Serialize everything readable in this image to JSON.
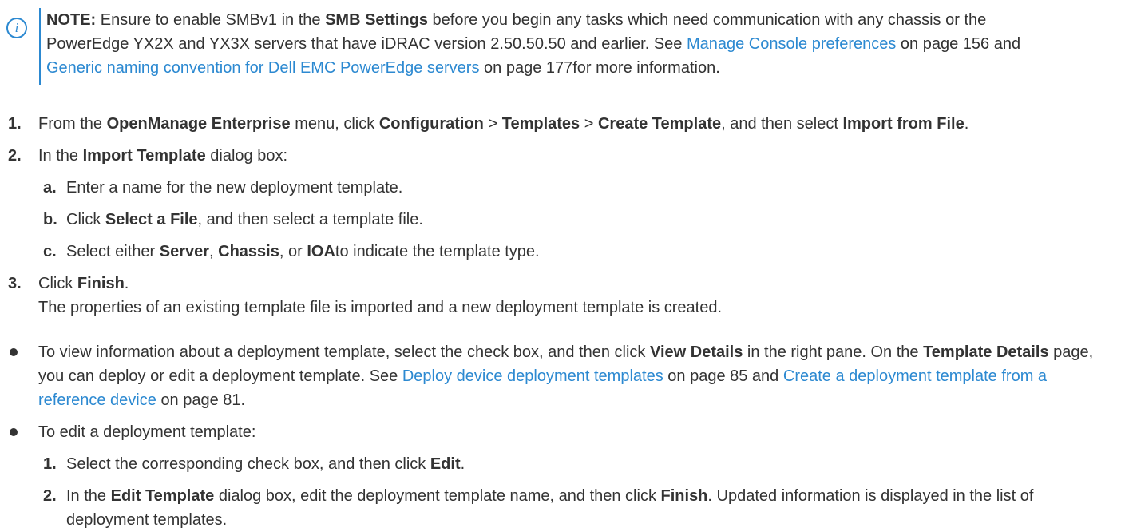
{
  "note": {
    "label": "NOTE:",
    "t1": "Ensure to enable SMBv1 in the",
    "b1": "SMB Settings",
    "t2": "before you begin any tasks which need communication with any chassis or the PowerEdge YX2X and YX3X servers that have iDRAC version 2.50.50.50 and earlier. See",
    "link1": "Manage Console preferences",
    "t3": "on page 156 and",
    "link2": "Generic naming convention for Dell EMC PowerEdge servers",
    "t4": "on page 177for more information."
  },
  "steps": [
    {
      "num": "1.",
      "p1": "From the",
      "b1": "OpenManage Enterprise",
      "p2": "menu, click",
      "b2": "Configuration",
      "s1": ">",
      "b3": "Templates",
      "s2": ">",
      "b4": "Create Template",
      "p3": ", and then select",
      "b5": "Import from File",
      "p4": "."
    },
    {
      "num": "2.",
      "p1": "In the",
      "b1": "Import Template",
      "p2": "dialog box:",
      "sub": [
        {
          "num": "a.",
          "text": "Enter a name for the new deployment template."
        },
        {
          "num": "b.",
          "p1": "Click",
          "b1": "Select a File",
          "p2": ", and then select a template file."
        },
        {
          "num": "c.",
          "p1": "Select either",
          "b1": "Server",
          "c1": ",",
          "b2": "Chassis",
          "c2": ", or",
          "b3": "IOA",
          "p2": "to indicate the template type."
        }
      ]
    },
    {
      "num": "3.",
      "p1": "Click",
      "b1": "Finish",
      "p2": ".",
      "result": "The properties of an existing template file is imported and a new deployment template is created."
    }
  ],
  "bullets": [
    {
      "t1": "To view information about a deployment template, select the check box, and then click",
      "b1": "View Details",
      "t2": "in the right pane. On the",
      "b2": "Template Details",
      "t3": "page, you can deploy or edit a deployment template. See",
      "link1": "Deploy device deployment templates",
      "t4": "on page 85 and",
      "link2": "Create a deployment template from a reference device",
      "t5": "on page 81."
    },
    {
      "t1": "To edit a deployment template:",
      "sub": [
        {
          "num": "1.",
          "p1": "Select the corresponding check box, and then click",
          "b1": "Edit",
          "p2": "."
        },
        {
          "num": "2.",
          "p1": "In the",
          "b1": "Edit Template",
          "p2": "dialog box, edit the deployment template name, and then click",
          "b2": "Finish",
          "p3": ". Updated information is displayed in the list of deployment templates."
        }
      ]
    }
  ]
}
